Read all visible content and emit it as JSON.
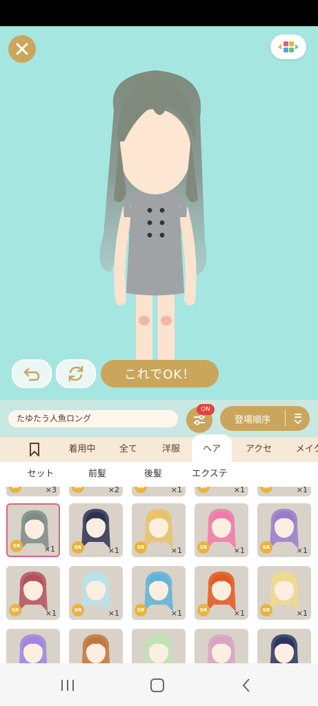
{
  "header": {
    "ok_button": "これでOK！"
  },
  "item": {
    "name": "たゆたう人魚ロング"
  },
  "filter": {
    "badge": "ON"
  },
  "sort": {
    "label": "登場順序"
  },
  "tabs": [
    "着用中",
    "全て",
    "洋服",
    "ヘア",
    "アクセ",
    "メイク"
  ],
  "active_tab": "ヘア",
  "subtabs": [
    "セット",
    "前髪",
    "後髪",
    "エクステ"
  ],
  "grid": {
    "top_row_counts": [
      "×3",
      "×2",
      "×1",
      "×1",
      "×1"
    ],
    "rows": [
      [
        {
          "rarity": "SR",
          "count": "×1",
          "hair": "#7d8c86",
          "selected": true
        },
        {
          "rarity": "SR",
          "count": "×1",
          "hair": "#2c3350",
          "selected": false
        },
        {
          "rarity": "SR",
          "count": "×1",
          "hair": "#e9c36a",
          "selected": false
        },
        {
          "rarity": "SR",
          "count": "×1",
          "hair": "#f07aa7",
          "selected": false
        },
        {
          "rarity": "SR",
          "count": "×1",
          "hair": "#9a7ccd",
          "selected": false
        }
      ],
      [
        {
          "rarity": "SR",
          "count": "×1",
          "hair": "#b3525a",
          "selected": false
        },
        {
          "rarity": "SR",
          "count": "×1",
          "hair": "#b9e3ea",
          "selected": false
        },
        {
          "rarity": "SR",
          "count": "×1",
          "hair": "#5fb3d8",
          "selected": false
        },
        {
          "rarity": "SR",
          "count": "×1",
          "hair": "#e25a1e",
          "selected": false
        },
        {
          "rarity": "SR",
          "count": "×1",
          "hair": "#f1d98c",
          "selected": false
        }
      ],
      [
        {
          "hair": "#9f84e0"
        },
        {
          "hair": "#c2773e"
        },
        {
          "hair": "#bfe3b5"
        },
        {
          "hair": "#d9a3c2"
        },
        {
          "hair": "#2a3560"
        }
      ]
    ]
  },
  "colors": {
    "gold": "#c9a65c",
    "stage_bg": "#a6e6e1",
    "badge_red": "#e7403a",
    "selected_border": "#e2617a"
  }
}
